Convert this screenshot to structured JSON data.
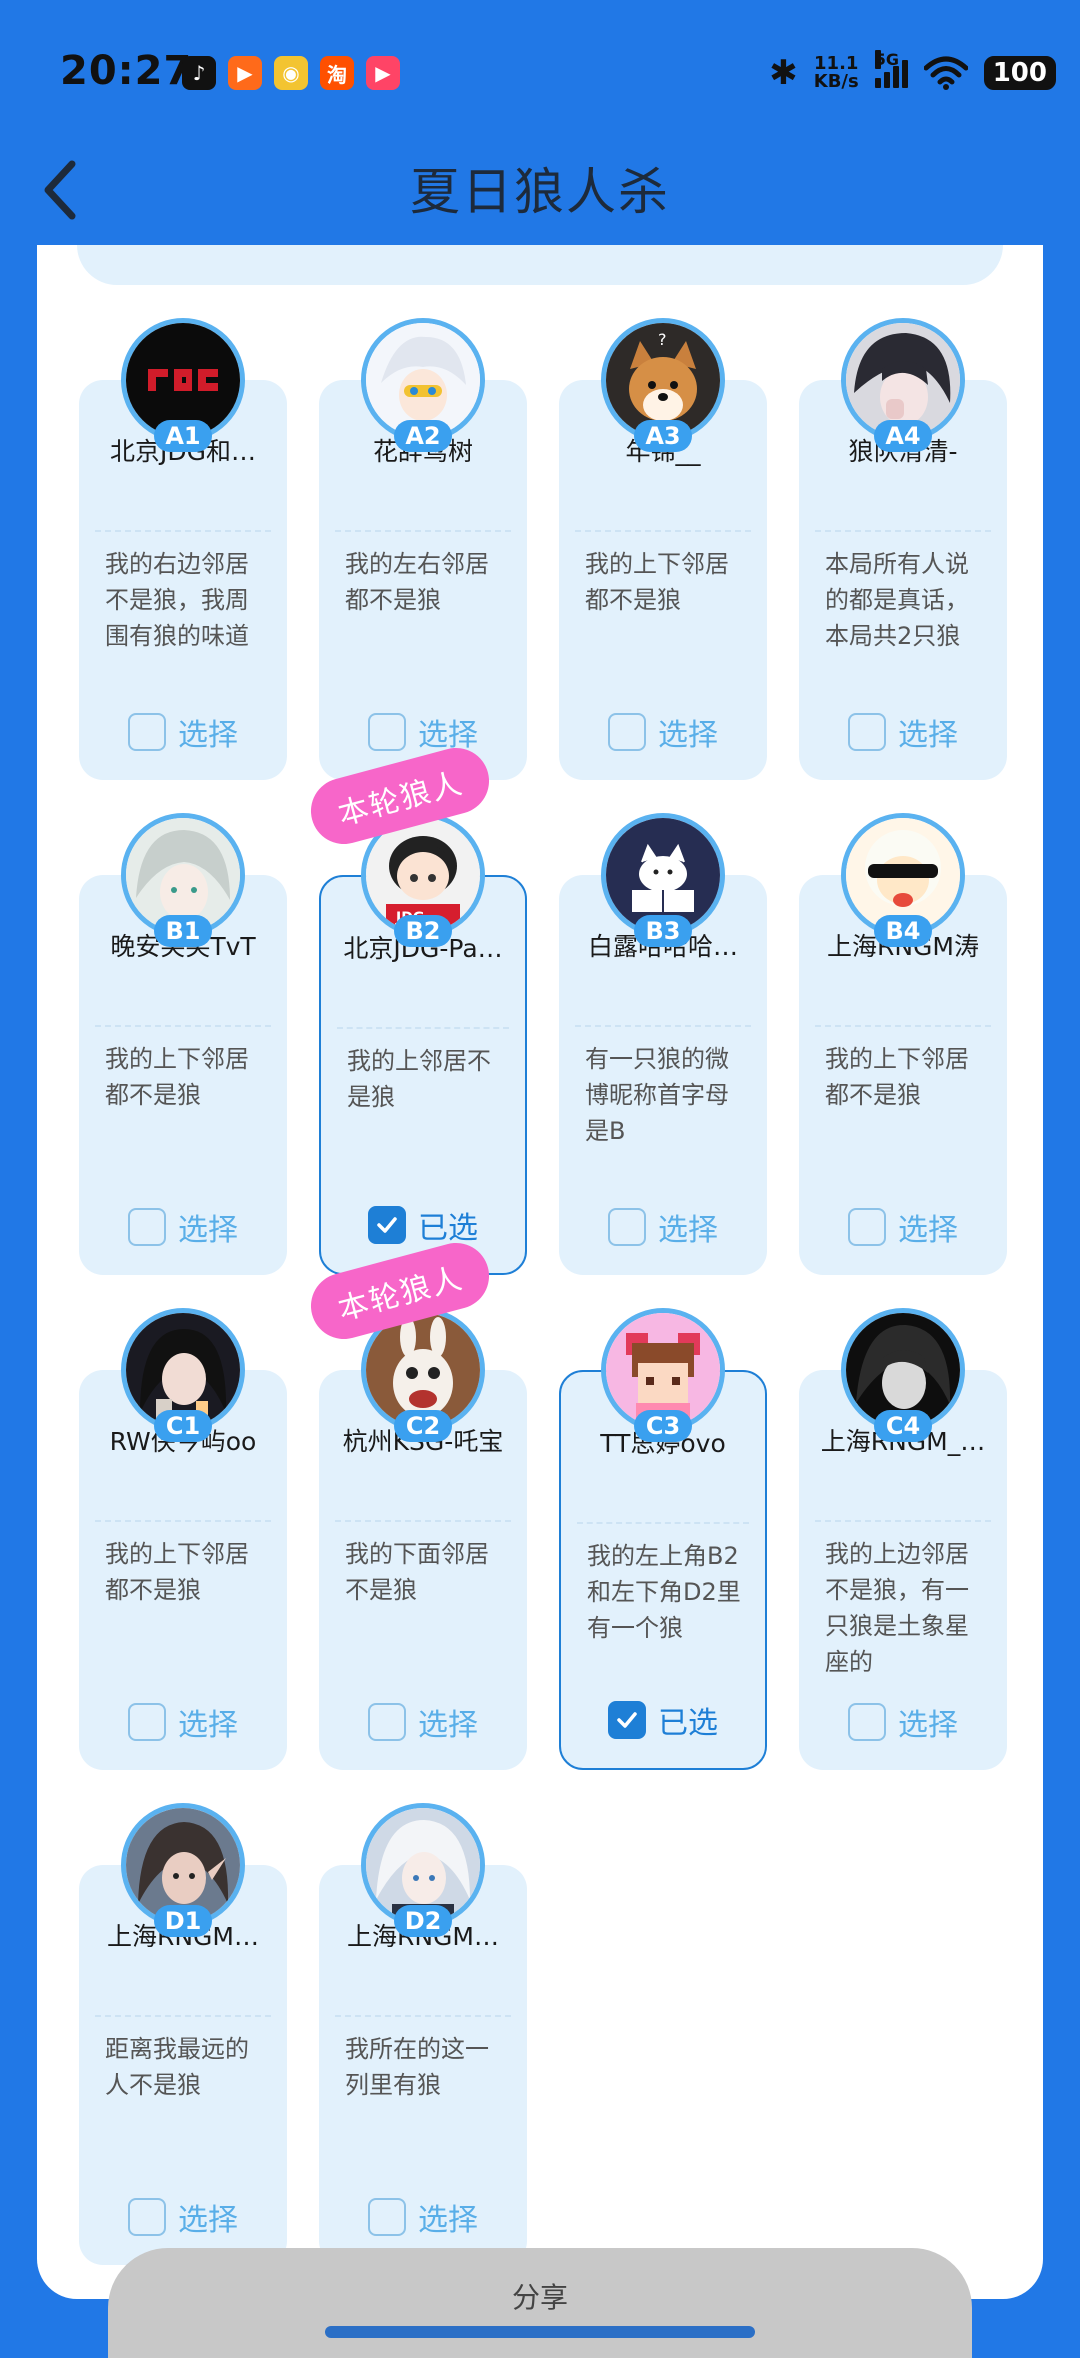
{
  "status_bar": {
    "time": "20:27",
    "apps": [
      {
        "icon": "tiktok-icon",
        "glyph": "♪",
        "color": "#111111"
      },
      {
        "icon": "kuaishou-icon",
        "glyph": "▶",
        "color": "#ff6a1a"
      },
      {
        "icon": "weibo-icon",
        "glyph": "◉",
        "color": "#f3c431"
      },
      {
        "icon": "taobao-icon",
        "glyph": "淘",
        "color": "#ff5000"
      },
      {
        "icon": "kuaishou-lite-icon",
        "glyph": "▶",
        "color": "#ff4466"
      }
    ],
    "speed_value": "11.1",
    "speed_unit": "KB/s",
    "network": "5G",
    "battery": "100"
  },
  "header": {
    "title": "夏日狼人杀"
  },
  "labels": {
    "choose": "选择",
    "chosen": "已选",
    "wolf_tag": "本轮狼人"
  },
  "players": [
    {
      "seat": "A1",
      "name": "北京JDG和…",
      "note": "我的右边邻居不是狼，我周围有狼的味道",
      "selected": false,
      "wolf": false,
      "avatar": "jdg-logo"
    },
    {
      "seat": "A2",
      "name": "花辞鸢树",
      "note": "我的左右邻居都不是狼",
      "selected": false,
      "wolf": false,
      "avatar": "white-hair-anime"
    },
    {
      "seat": "A3",
      "name": "年锦__",
      "note": "我的上下邻居都不是狼",
      "selected": false,
      "wolf": false,
      "avatar": "shiba-dog"
    },
    {
      "seat": "A4",
      "name": "狼队清清-",
      "note": "本局所有人说的都是真话，本局共2只狼",
      "selected": false,
      "wolf": false,
      "avatar": "dark-hair-anime"
    },
    {
      "seat": "B1",
      "name": "晚安笑笑TvT",
      "note": "我的上下邻居都不是狼",
      "selected": false,
      "wolf": false,
      "avatar": "silver-hair-anime"
    },
    {
      "seat": "B2",
      "name": "北京JDG-Pa…",
      "note": "我的上邻居不是狼",
      "selected": true,
      "wolf": true,
      "avatar": "chibi-boy"
    },
    {
      "seat": "B3",
      "name": "白露哈哈哈…",
      "note": "有一只狼的微博昵称首字母是B",
      "selected": false,
      "wolf": false,
      "avatar": "cat-reading"
    },
    {
      "seat": "B4",
      "name": "上海RNGM涛",
      "note": "我的上下邻居都不是狼",
      "selected": false,
      "wolf": false,
      "avatar": "sheep-sunglasses"
    },
    {
      "seat": "C1",
      "name": "RW侠今屿oo",
      "note": "我的上下邻居都不是狼",
      "selected": false,
      "wolf": false,
      "avatar": "girl-drink"
    },
    {
      "seat": "C2",
      "name": "杭州KSG-吒宝",
      "note": "我的下面邻居不是狼",
      "selected": false,
      "wolf": true,
      "avatar": "rabbid"
    },
    {
      "seat": "C3",
      "name": "TT思婷ovo",
      "note": "我的左上角B2和左下角D2里有一个狼",
      "selected": true,
      "wolf": false,
      "avatar": "pixel-girl"
    },
    {
      "seat": "C4",
      "name": "上海RNGM_…",
      "note": "我的上边邻居不是狼，有一只狼是土象星座的",
      "selected": false,
      "wolf": false,
      "avatar": "dark-bw-anime"
    },
    {
      "seat": "D1",
      "name": "上海RNGM…",
      "note": "距离我最远的人不是狼",
      "selected": false,
      "wolf": false,
      "avatar": "elf-girl"
    },
    {
      "seat": "D2",
      "name": "上海RNGM…",
      "note": "我所在的这一列里有狼",
      "selected": false,
      "wolf": false,
      "avatar": "white-hair-boy"
    }
  ],
  "share": {
    "label": "分享"
  }
}
